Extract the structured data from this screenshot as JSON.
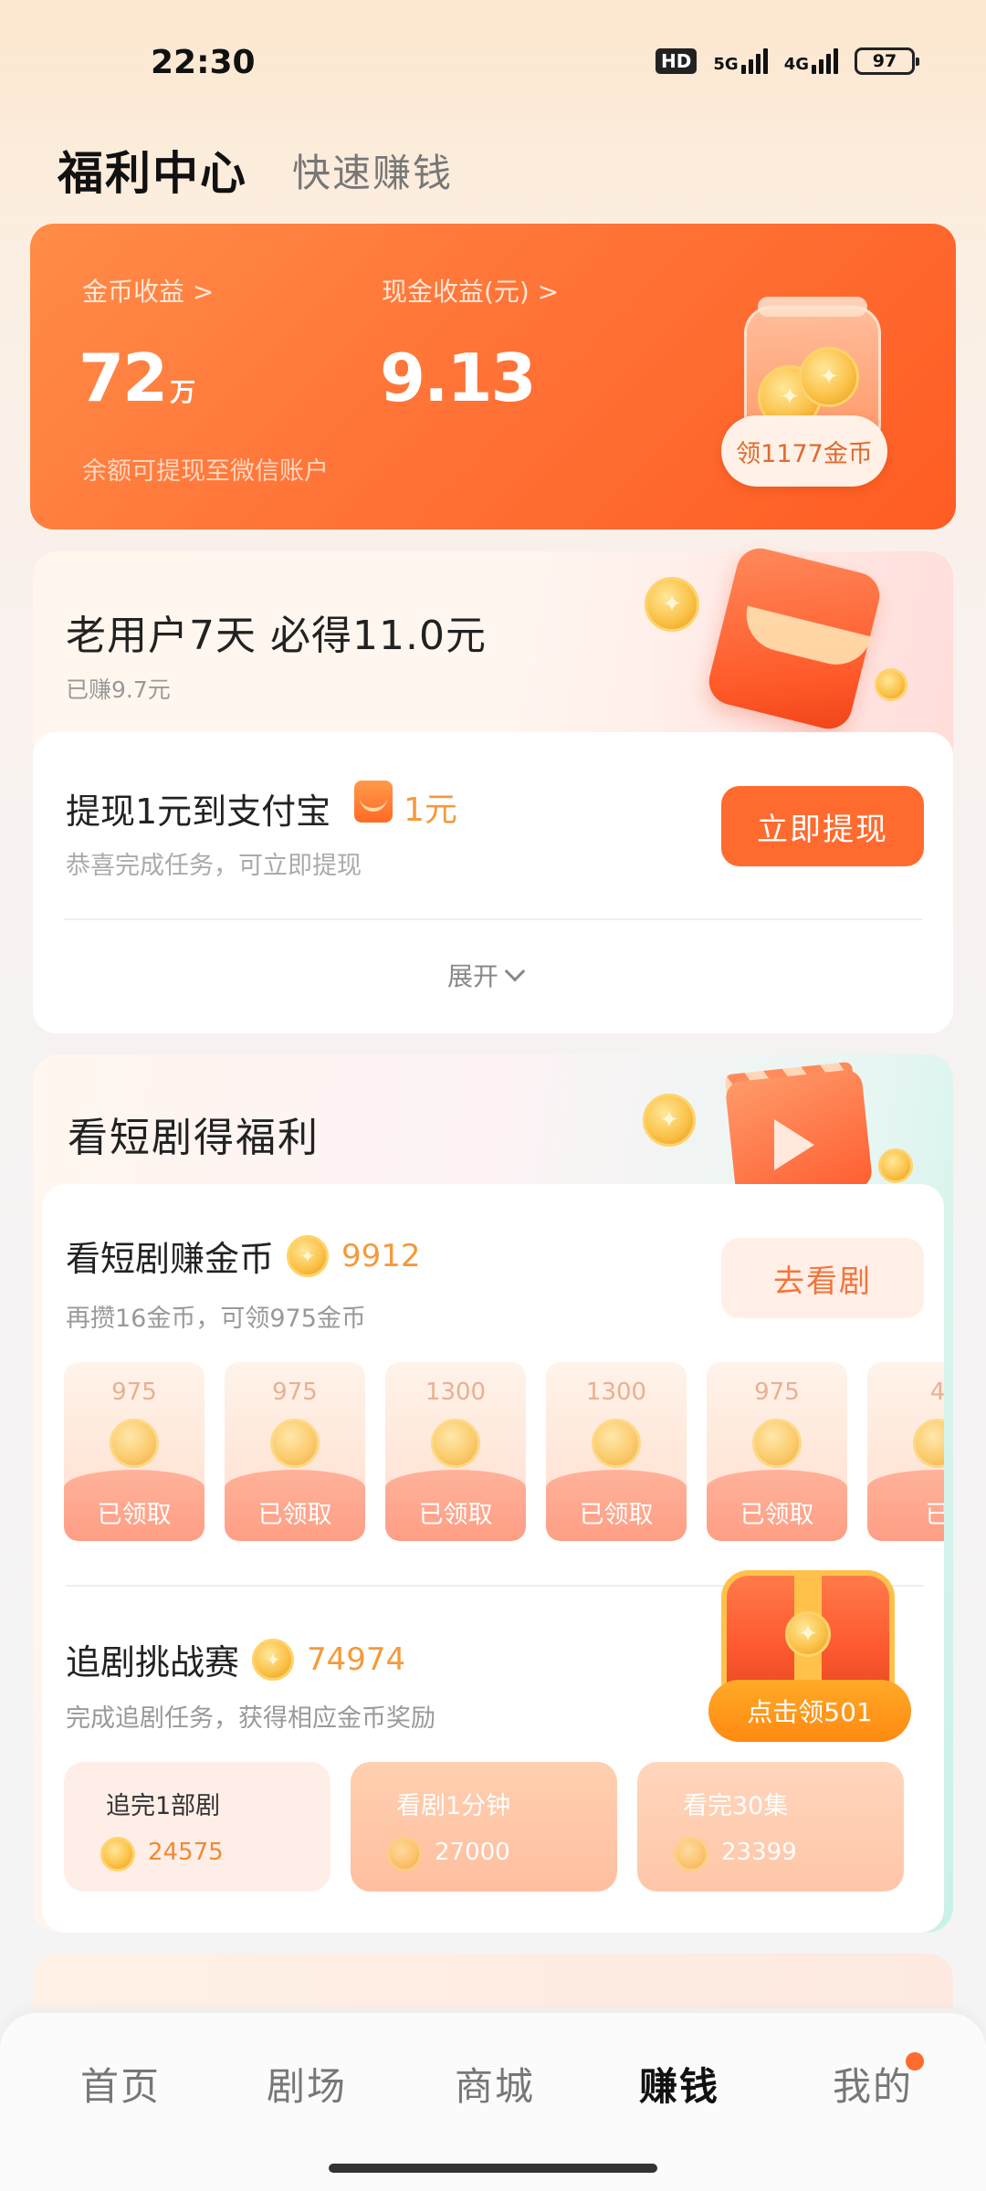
{
  "status_bar": {
    "time": "22:30",
    "hd_tag": "HD",
    "network_1": "5G",
    "network_2": "4G",
    "battery": "97"
  },
  "header": {
    "title": "福利中心",
    "subtitle": "快速赚钱"
  },
  "earnings": {
    "coin_label": "金币收益 >",
    "coin_value": "72",
    "coin_unit": "万",
    "cash_label": "现金收益(元) >",
    "cash_value": "9.13",
    "hint": "余额可提现至微信账户",
    "collect_button": "领1177金币"
  },
  "old_user": {
    "title": "老用户7天 必得11.0元",
    "earned": "已赚9.7元",
    "withdraw_title": "提现1元到支付宝",
    "withdraw_amount": "1元",
    "withdraw_sub": "恭喜完成任务，可立即提现",
    "withdraw_button": "立即提现",
    "expand_label": "展开"
  },
  "drama": {
    "section_title": "看短剧得福利",
    "watch_title": "看短剧赚金币",
    "watch_coins": "9912",
    "watch_sub": "再攒16金币，可领975金币",
    "watch_button": "去看剧",
    "rewards": [
      {
        "value": "975",
        "label": "已领取"
      },
      {
        "value": "975",
        "label": "已领取"
      },
      {
        "value": "1300",
        "label": "已领取"
      },
      {
        "value": "1300",
        "label": "已领取"
      },
      {
        "value": "975",
        "label": "已领取"
      },
      {
        "value": "4",
        "label": "已"
      }
    ],
    "challenge_title": "追剧挑战赛",
    "challenge_coins": "74974",
    "challenge_sub": "完成追剧任务，获得相应金币奖励",
    "challenge_button": "点击领501",
    "tasks": [
      {
        "title": "追完1部剧",
        "value": "24575"
      },
      {
        "title": "看剧1分钟",
        "value": "27000"
      },
      {
        "title": "看完30集",
        "value": "23399"
      }
    ]
  },
  "tabbar": {
    "items": [
      "首页",
      "剧场",
      "商城",
      "赚钱",
      "我的"
    ],
    "active": "赚钱"
  },
  "colors": {
    "accent": "#ff6a2e",
    "coin_text": "#f59a3a",
    "button_yellow": "#ff9a1a"
  }
}
